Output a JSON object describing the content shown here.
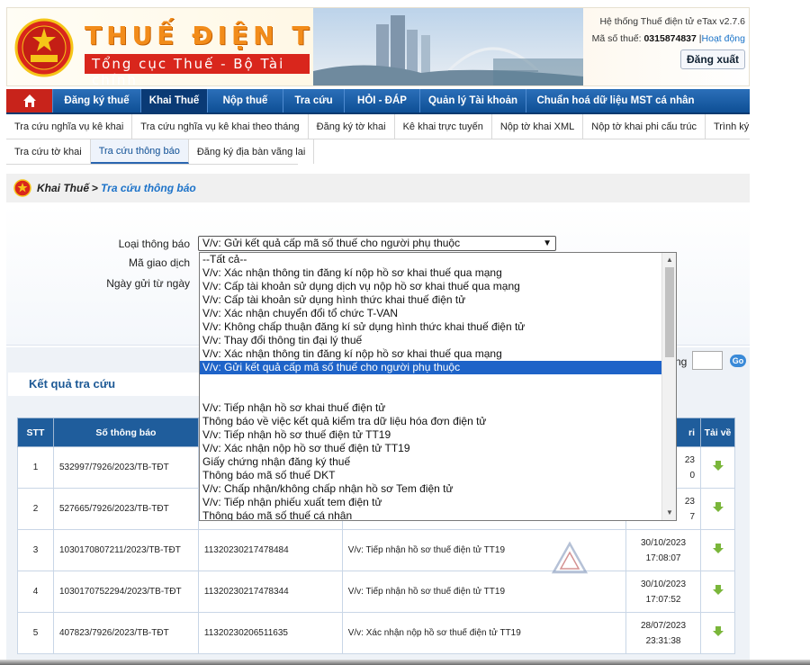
{
  "header": {
    "brand_title": "THUẾ ĐIỆN TỬ",
    "brand_subtitle": "Tổng cục Thuế - Bộ Tài chính",
    "emblem_text": "THUẾ NHÀ NƯỚC",
    "system_name": "Hệ thống Thuế điện tử eTax v2.7.6",
    "tax_code_label": "Mã số thuế:",
    "tax_code": "0315874837",
    "status_sep": "|",
    "status": "Hoạt động",
    "logout_label": "Đăng xuất"
  },
  "main_nav": [
    "Đăng ký thuế",
    "Khai Thuế",
    "Nộp thuế",
    "Tra cứu",
    "HỎI - ĐÁP",
    "Quản lý Tài khoản",
    "Chuẩn hoá dữ liệu MST cá nhân"
  ],
  "sub_nav_row1": [
    "Tra cứu nghĩa vụ kê khai",
    "Tra cứu nghĩa vụ kê khai theo tháng",
    "Đăng ký tờ khai",
    "Kê khai trực tuyến",
    "Nộp tờ khai XML",
    "Nộp tờ khai phi cấu trúc",
    "Trình ký"
  ],
  "sub_nav_row2": [
    "Tra cứu tờ khai",
    "Tra cứu thông báo",
    "Đăng ký địa bàn vãng lai"
  ],
  "breadcrumb": {
    "section": "Khai Thuế",
    "separator": ">",
    "page": "Tra cứu thông báo"
  },
  "form": {
    "notice_type_label": "Loại thông báo",
    "transaction_code_label": "Mã giao dịch",
    "send_date_label": "Ngày gửi từ ngày",
    "notice_type_value": "V/v: Gửi kết quả cấp mã số thuế cho người phụ thuộc"
  },
  "dropdown_options": [
    "--Tất cả--",
    "V/v: Xác nhận thông tin đăng kí nộp hồ sơ khai thuế qua mạng",
    "V/v: Cấp tài khoản sử dụng dịch vụ nộp hồ sơ khai thuế qua mạng",
    "V/v: Cấp tài khoản sử dụng hình thức khai thuế điện tử",
    "V/v: Xác nhận chuyển đổi tổ chức T-VAN",
    "V/v: Không chấp thuận đăng kí sử dụng hình thức khai thuế điện tử",
    "V/v: Thay đổi thông tin đại lý thuế",
    "V/v: Xác nhận thông tin đăng kí nộp hồ sơ khai thuế qua mạng",
    "V/v: Gửi kết quả cấp mã số thuế cho người phụ thuộc",
    "",
    "",
    "V/v: Tiếp nhận hồ sơ khai thuế điện tử",
    "Thông báo về việc kết quả kiểm tra dữ liệu hóa đơn điện tử",
    "V/v: Tiếp nhận hồ sơ thuế điện tử TT19",
    "V/v: Xác nhận nộp hồ sơ thuế điện tử TT19",
    "Giấy chứng nhận đăng ký thuế",
    "Thông báo mã số thuế DKT",
    "V/v: Chấp nhận/không chấp nhận hồ sơ Tem điện tử",
    "V/v: Tiếp nhận phiếu xuất tem điện tử",
    "Thông báo mã số thuế cá nhân"
  ],
  "results": {
    "title": "Kết quả tra cứu",
    "page_label": "ng",
    "go_label": "Go",
    "columns": [
      "STT",
      "Số thông báo",
      "",
      "",
      "ri",
      "Tải về"
    ],
    "rows": [
      {
        "stt": "1",
        "so_tb": "532997/7926/2023/TB-TĐT",
        "ma_gd": "",
        "noi_dung": "",
        "ngay": "23",
        "gio": "0"
      },
      {
        "stt": "2",
        "so_tb": "527665/7926/2023/TB-TĐT",
        "ma_gd": "",
        "noi_dung": "",
        "ngay": "23",
        "gio": "7"
      },
      {
        "stt": "3",
        "so_tb": "1030170807211/2023/TB-TĐT",
        "ma_gd": "11320230217478484",
        "noi_dung": "V/v: Tiếp nhận hồ sơ thuế điện tử TT19",
        "ngay": "30/10/2023",
        "gio": "17:08:07"
      },
      {
        "stt": "4",
        "so_tb": "1030170752294/2023/TB-TĐT",
        "ma_gd": "11320230217478344",
        "noi_dung": "V/v: Tiếp nhận hồ sơ thuế điện tử TT19",
        "ngay": "30/10/2023",
        "gio": "17:07:52"
      },
      {
        "stt": "5",
        "so_tb": "407823/7926/2023/TB-TĐT",
        "ma_gd": "11320230206511635",
        "noi_dung": "V/v: Xác nhận nộp hồ sơ thuế điện tử TT19",
        "ngay": "28/07/2023",
        "gio": "23:31:38"
      }
    ]
  },
  "colors": {
    "nav_blue": "#1f5d9c",
    "brand_orange": "#f28c1a",
    "brand_red": "#d9261c",
    "link_blue": "#1d73c9",
    "selected": "#1e63c8"
  }
}
